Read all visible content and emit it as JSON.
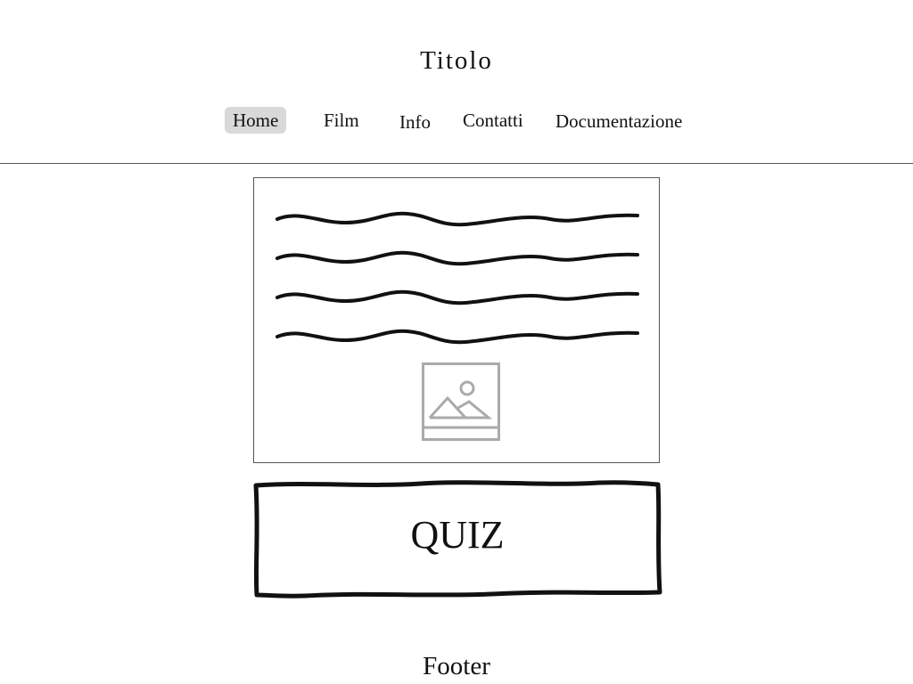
{
  "header": {
    "title": "Titolo"
  },
  "nav": {
    "items": [
      {
        "label": "Home",
        "active": true
      },
      {
        "label": "Film",
        "active": false
      },
      {
        "label": "Info",
        "active": false
      },
      {
        "label": "Contatti",
        "active": false
      },
      {
        "label": "Documentazione",
        "active": false
      }
    ]
  },
  "main": {
    "content_icon": "image-placeholder-icon",
    "quiz_label": "QUIZ"
  },
  "footer": {
    "label": "Footer"
  },
  "colors": {
    "active_nav_bg": "#d9d9d9",
    "border": "#555555",
    "placeholder_icon": "#aaaaaa",
    "ink": "#111111"
  }
}
